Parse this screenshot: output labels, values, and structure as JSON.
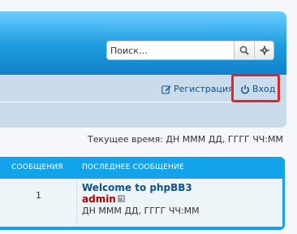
{
  "header": {
    "search": {
      "placeholder": "Поиск…",
      "search_icon": "search-icon",
      "advanced_icon": "gear-icon"
    }
  },
  "navbar": {
    "register_label": "Регистрация",
    "login_label": "Вход"
  },
  "current_time": "Текущее время: ДН МММ ДД, ГГГГ ЧЧ:ММ",
  "table": {
    "headers": {
      "posts": "СООБЩЕНИЯ",
      "last_post": "ПОСЛЕДНЕЕ СООБЩЕНИЕ"
    },
    "rows": [
      {
        "posts": "1",
        "last_post_title": "Welcome to phpBB3",
        "last_post_author": "admin",
        "last_post_time": "ДН МММ ДД, ГГГГ ЧЧ:ММ"
      }
    ]
  },
  "colors": {
    "accent": "#1e9be0",
    "link": "#105289",
    "author": "#aa0000",
    "highlight": "#e0262b"
  }
}
